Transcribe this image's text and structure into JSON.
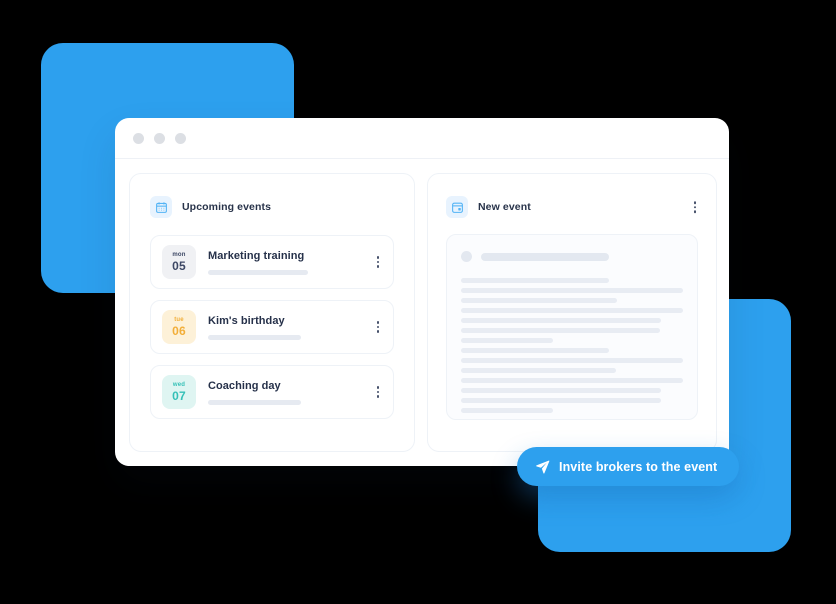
{
  "theme": {
    "accent_blue": "#2da0ee",
    "panel_border": "#eef2f7",
    "text_dark": "#26314a",
    "skeleton_gray": "#e8ecf3"
  },
  "window": {
    "titlebar": {
      "dots": [
        "window-dot-close",
        "window-dot-minimize",
        "window-dot-maximize"
      ]
    }
  },
  "left_panel": {
    "icon": "calendar-icon",
    "title": "Upcoming events",
    "events": [
      {
        "dow": "mon",
        "day": "05",
        "title": "Marketing training",
        "badge_bg": "#f0f1f4",
        "badge_fg": "#3c4764",
        "subtitle_bar_width": 100,
        "menu": "row-kebab-menu"
      },
      {
        "dow": "tue",
        "day": "06",
        "title": "Kim's birthday",
        "badge_bg": "#fdf1d8",
        "badge_fg": "#f2ae38",
        "subtitle_bar_width": 93,
        "menu": "row-kebab-menu"
      },
      {
        "dow": "wed",
        "day": "07",
        "title": "Coaching day",
        "badge_bg": "#dff5f2",
        "badge_fg": "#35c0b7",
        "subtitle_bar_width": 93,
        "menu": "row-kebab-menu"
      }
    ]
  },
  "right_panel": {
    "icon": "event-card-icon",
    "title": "New event",
    "menu": "panel-kebab-menu",
    "skeleton": {
      "head_bar_width": 128,
      "line_widths": [
        148,
        222,
        156,
        222,
        200,
        199,
        92,
        148,
        222,
        155,
        222,
        200,
        200,
        92
      ]
    }
  },
  "cta": {
    "icon": "send-icon",
    "label": "Invite brokers to the event"
  }
}
